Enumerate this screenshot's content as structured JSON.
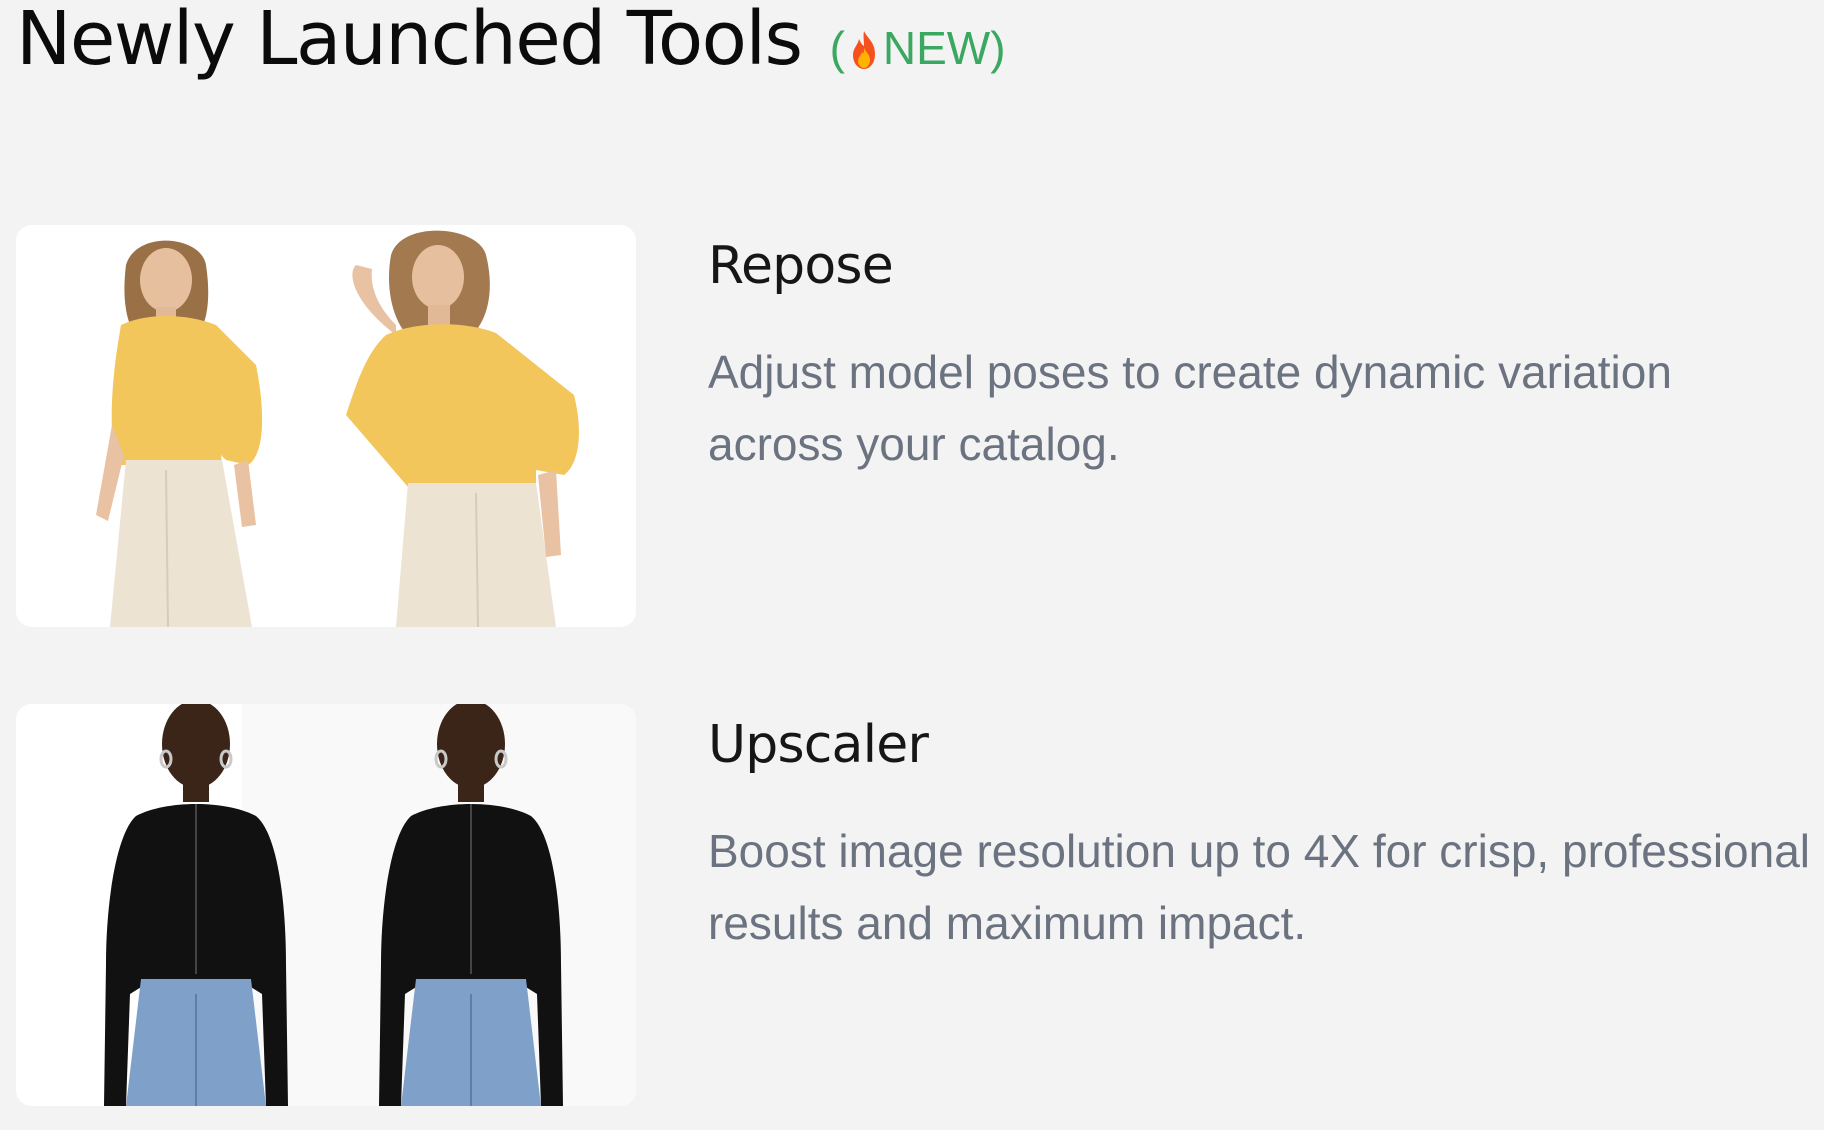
{
  "header": {
    "title": "Newly Launched Tools",
    "badge_open": "(",
    "badge_label": "NEW)",
    "badge_color": "#3aa860"
  },
  "tools": [
    {
      "name": "Repose",
      "description": "Adjust model poses to create dynamic variation across your catalog.",
      "image": "two-models-yellow-blouse"
    },
    {
      "name": "Upscaler",
      "description": "Boost image resolution up to 4X for crisp, professional results and maximum impact.",
      "image": "two-models-black-top-jeans"
    }
  ]
}
